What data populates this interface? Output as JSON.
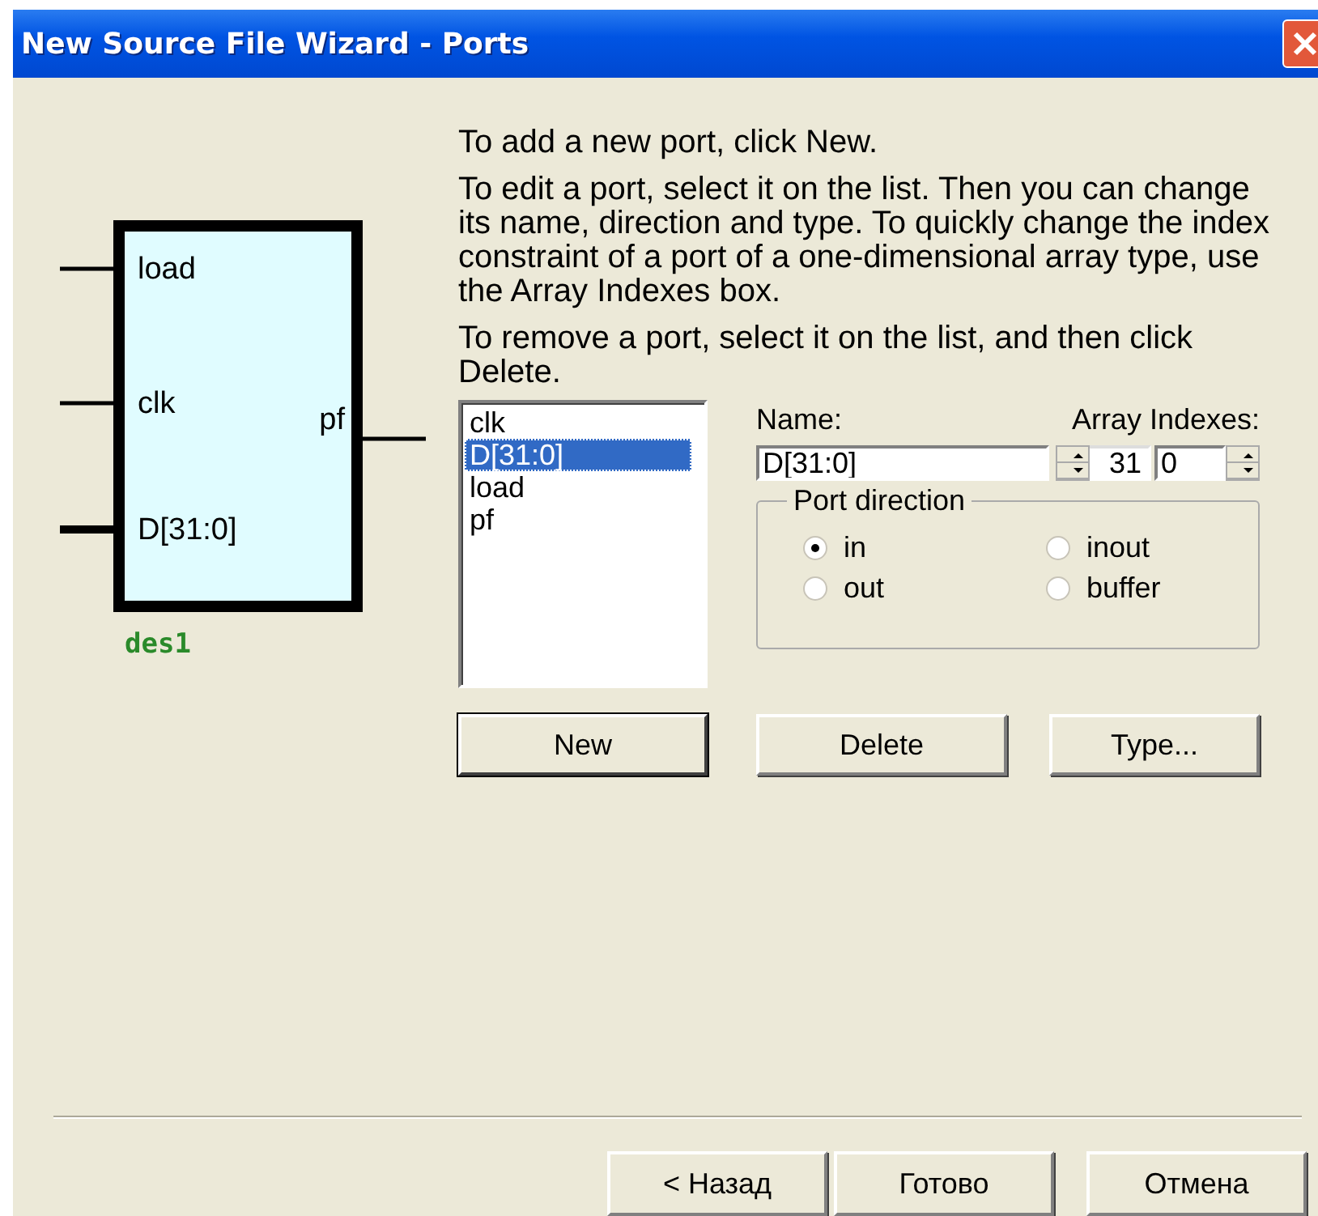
{
  "window": {
    "title": "New Source File Wizard - Ports"
  },
  "symbol": {
    "name": "des1",
    "inputs": [
      {
        "label": "load",
        "bus": false
      },
      {
        "label": "clk",
        "bus": false
      },
      {
        "label": "D[31:0]",
        "bus": true
      }
    ],
    "outputs": [
      {
        "label": "pf",
        "bus": false
      }
    ]
  },
  "instructions": [
    "To add a new port, click New.",
    "To edit a port, select it on the list. Then you can change its name, direction and type. To quickly change the index constraint of a port of a one-dimensional array type, use the Array Indexes box.",
    "To remove a port, select it on the list, and then click Delete."
  ],
  "ports_list": [
    {
      "label": "clk",
      "selected": false
    },
    {
      "label": "D[31:0]",
      "selected": true
    },
    {
      "label": "load",
      "selected": false
    },
    {
      "label": "pf",
      "selected": false
    }
  ],
  "name_field": {
    "label": "Name:",
    "value": "D[31:0]"
  },
  "array_indexes": {
    "label": "Array Indexes:",
    "high": "31",
    "low": "0"
  },
  "port_direction": {
    "title": "Port direction",
    "options": [
      {
        "label": "in",
        "selected": true
      },
      {
        "label": "inout",
        "selected": false
      },
      {
        "label": "out",
        "selected": false
      },
      {
        "label": "buffer",
        "selected": false
      }
    ]
  },
  "port_buttons": [
    {
      "label": "New",
      "focused": true
    },
    {
      "label": "Delete",
      "focused": false
    },
    {
      "label": "Type...",
      "focused": false
    }
  ],
  "nav_buttons": [
    {
      "label": "< Назад"
    },
    {
      "label": "Готово"
    },
    {
      "label": "Отмена"
    }
  ]
}
